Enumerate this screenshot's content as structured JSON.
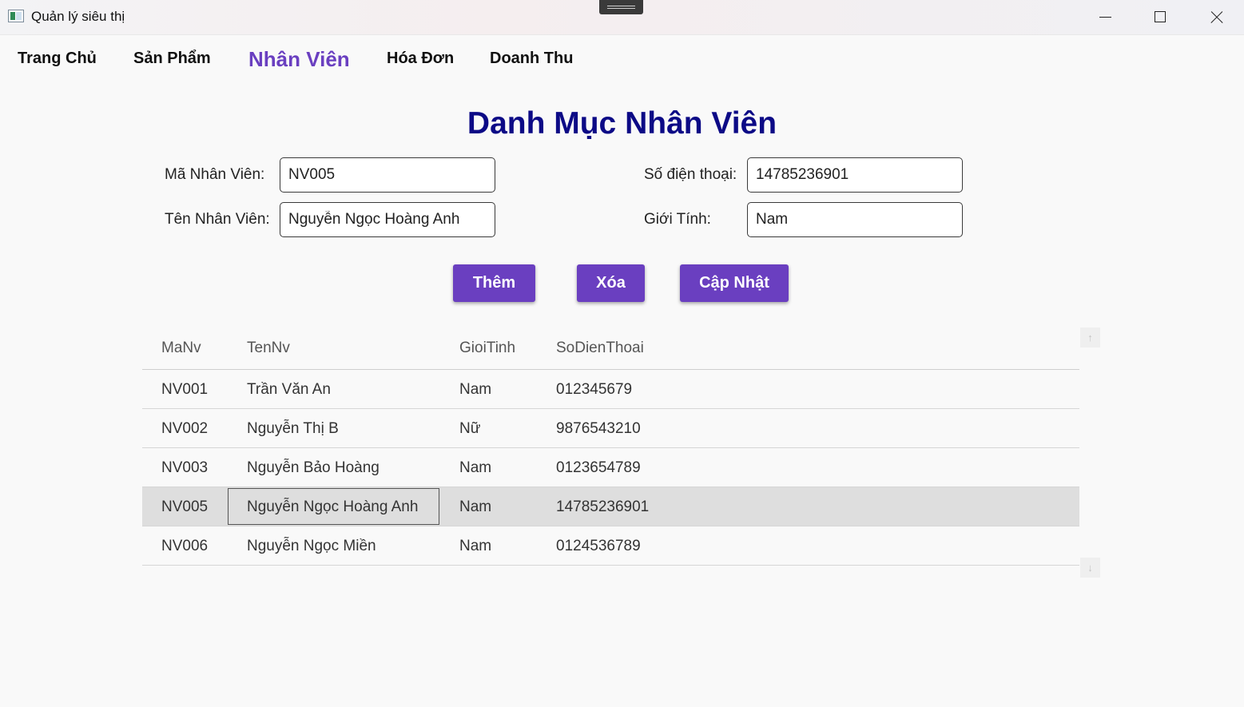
{
  "window": {
    "title": "Quản lý siêu thị"
  },
  "nav": {
    "items": [
      {
        "label": "Trang Chủ",
        "active": false
      },
      {
        "label": "Sản Phẩm",
        "active": false
      },
      {
        "label": "Nhân Viên",
        "active": true
      },
      {
        "label": "Hóa Đơn",
        "active": false
      },
      {
        "label": "Doanh Thu",
        "active": false
      }
    ]
  },
  "page": {
    "title": "Danh Mục Nhân Viên"
  },
  "form": {
    "ma_nv_label": "Mã Nhân Viên:",
    "ma_nv_value": "NV005",
    "ten_nv_label": "Tên Nhân Viên:",
    "ten_nv_value": "Nguyễn Ngọc Hoàng Anh",
    "sdt_label": "Số điện thoại:",
    "sdt_value": "14785236901",
    "gioi_tinh_label": "Giới Tính:",
    "gioi_tinh_value": "Nam"
  },
  "actions": {
    "add": "Thêm",
    "delete": "Xóa",
    "update": "Cập Nhật"
  },
  "table": {
    "columns": [
      "MaNv",
      "TenNv",
      "GioiTinh",
      "SoDienThoai"
    ],
    "rows": [
      [
        "NV001",
        "Trần Văn An",
        "Nam",
        "012345679"
      ],
      [
        "NV002",
        "Nguyễn Thị B",
        "Nữ",
        "9876543210"
      ],
      [
        "NV003",
        "Nguyễn Bảo Hoàng",
        "Nam",
        "0123654789"
      ],
      [
        "NV005",
        "Nguyễn Ngọc Hoàng Anh",
        "Nam",
        "14785236901"
      ],
      [
        "NV006",
        "Nguyễn Ngọc Miền",
        "Nam",
        "0124536789"
      ]
    ],
    "selected_row": 3
  },
  "scroll": {
    "up_icon": "↑",
    "down_icon": "↓"
  },
  "colors": {
    "accent": "#6a3fc0",
    "title": "#0c0a86",
    "selected_row": "#dedede"
  }
}
